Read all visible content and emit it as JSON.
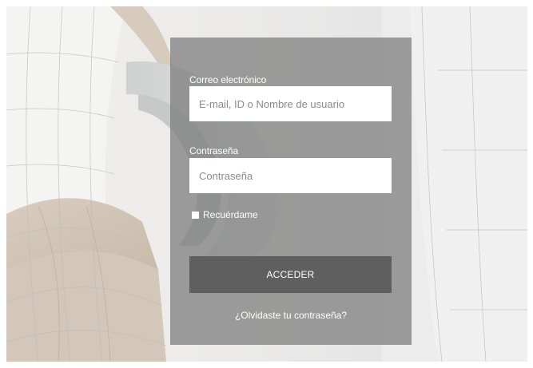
{
  "login": {
    "email_label": "Correo electrónico",
    "email_placeholder": "E-mail, ID o Nombre de usuario",
    "password_label": "Contraseña",
    "password_placeholder": "Contraseña",
    "remember_label": "Recuérdame",
    "remember_checked": false,
    "submit_label": "ACCEDER",
    "forgot_label": "¿Olvidaste tu contraseña?"
  },
  "colors": {
    "panel": "#7a7a7a",
    "button": "#5f5f5f",
    "text": "#ffffff"
  }
}
